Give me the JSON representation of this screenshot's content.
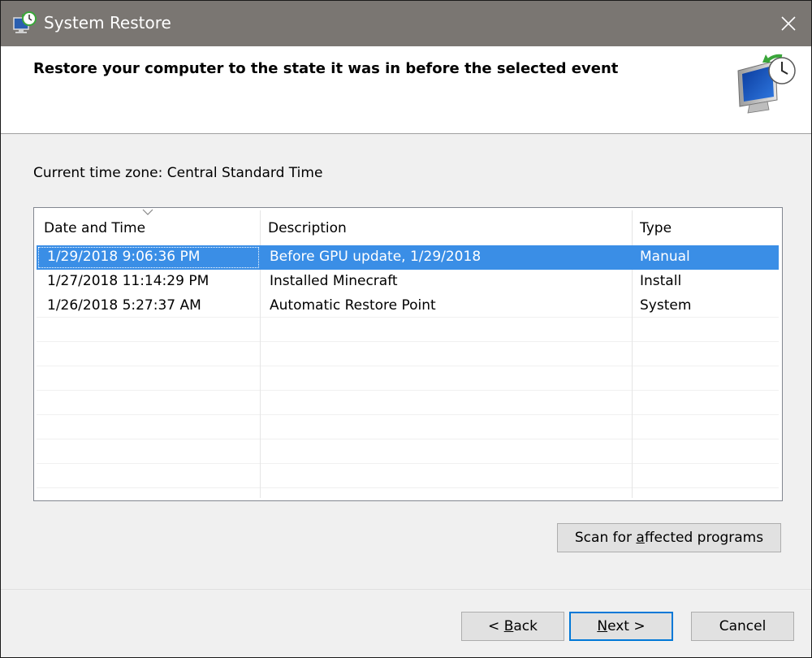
{
  "window": {
    "title": "System Restore",
    "close_glyph": "✕"
  },
  "header": {
    "heading": "Restore your computer to the state it was in before the selected event"
  },
  "timezone": {
    "label": "Current time zone: Central Standard Time"
  },
  "restore_points": {
    "columns": [
      "Date and Time",
      "Description",
      "Type"
    ],
    "rows": [
      {
        "date": "1/29/2018 9:06:36 PM",
        "description": "Before GPU update, 1/29/2018",
        "type": "Manual",
        "selected": true
      },
      {
        "date": "1/27/2018 11:14:29 PM",
        "description": "Installed Minecraft",
        "type": "Install",
        "selected": false
      },
      {
        "date": "1/26/2018 5:27:37 AM",
        "description": "Automatic Restore Point",
        "type": "System",
        "selected": false
      }
    ]
  },
  "buttons": {
    "scan": {
      "before": "Scan for ",
      "accel": "a",
      "after": "ffected programs"
    },
    "back": {
      "before": "< ",
      "accel": "B",
      "after": "ack"
    },
    "next": {
      "before": "",
      "accel": "N",
      "after": "ext >"
    },
    "cancel": {
      "label": "Cancel"
    }
  },
  "icons": {
    "app": "system-restore-icon",
    "header": "restore-computer-clock-icon",
    "sort": "chevron-down-icon",
    "close": "close-icon"
  },
  "colors": {
    "titlebar": "#7a7672",
    "selection": "#3a8ee6",
    "default_button_border": "#0078d7"
  }
}
